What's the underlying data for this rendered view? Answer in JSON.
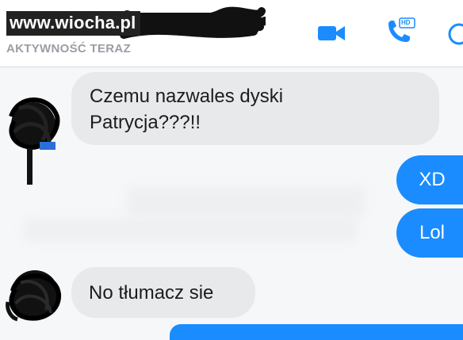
{
  "watermark": "www.wiocha.pl",
  "header": {
    "status": "AKTYWNOŚĆ TERAZ",
    "video_icon": "video-camera-icon",
    "call_icon": "phone-hd-icon",
    "call_badge": "HD",
    "info_icon": "info-circle-icon",
    "accent_color": "#1a8cff"
  },
  "messages": [
    {
      "from": "other",
      "text_line1": "Czemu nazwales dyski",
      "text_line2": "Patrycja???!!"
    },
    {
      "from": "me",
      "text": "XD"
    },
    {
      "from": "me",
      "text": "Lol"
    },
    {
      "from": "other",
      "text": "No tłumacz sie"
    }
  ]
}
